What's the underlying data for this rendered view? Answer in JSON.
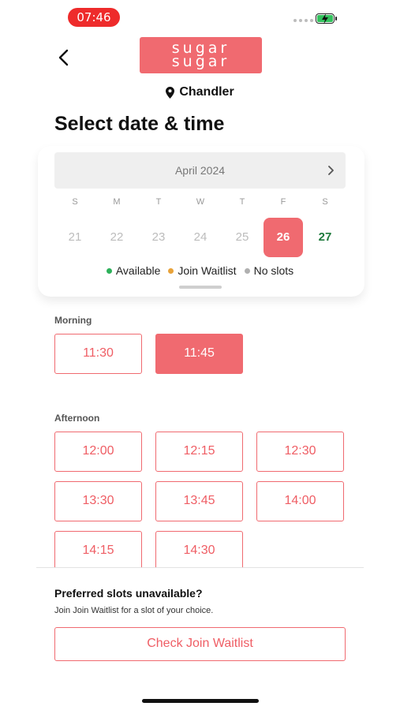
{
  "status_bar": {
    "time": "07:46",
    "battery_icon": "battery-charging-icon",
    "signal_icon": "signal-icon"
  },
  "header": {
    "back_icon": "chevron-left-icon",
    "logo_line1": "sugar",
    "logo_line2": "sugar",
    "location_icon": "map-pin-icon",
    "location": "Chandler"
  },
  "title": "Select date & time",
  "calendar": {
    "month": "April 2024",
    "next_icon": "chevron-right-icon",
    "weekdays": [
      "S",
      "M",
      "T",
      "W",
      "T",
      "F",
      "S"
    ],
    "days": [
      "21",
      "22",
      "23",
      "24",
      "25",
      "26",
      "27"
    ],
    "selected_day": "26",
    "available_day": "27",
    "legend": [
      {
        "label": "Available",
        "color": "#2db15a"
      },
      {
        "label": "Join Waitlist",
        "color": "#e8a23a"
      },
      {
        "label": "No slots",
        "color": "#b0b0b0"
      }
    ]
  },
  "morning": {
    "label": "Morning",
    "slots": [
      "11:30",
      "11:45"
    ],
    "selected": "11:45"
  },
  "afternoon": {
    "label": "Afternoon",
    "slots": [
      "12:00",
      "12:15",
      "12:30",
      "13:30",
      "13:45",
      "14:00",
      "14:15",
      "14:30"
    ]
  },
  "bottom": {
    "title": "Preferred slots unavailable?",
    "subtitle": "Join Join Waitlist for a slot of your choice.",
    "button": "Check Join Waitlist"
  },
  "colors": {
    "accent": "#f06a70",
    "status_pill": "#ee2b2b",
    "available_text": "#1e7a3c"
  }
}
